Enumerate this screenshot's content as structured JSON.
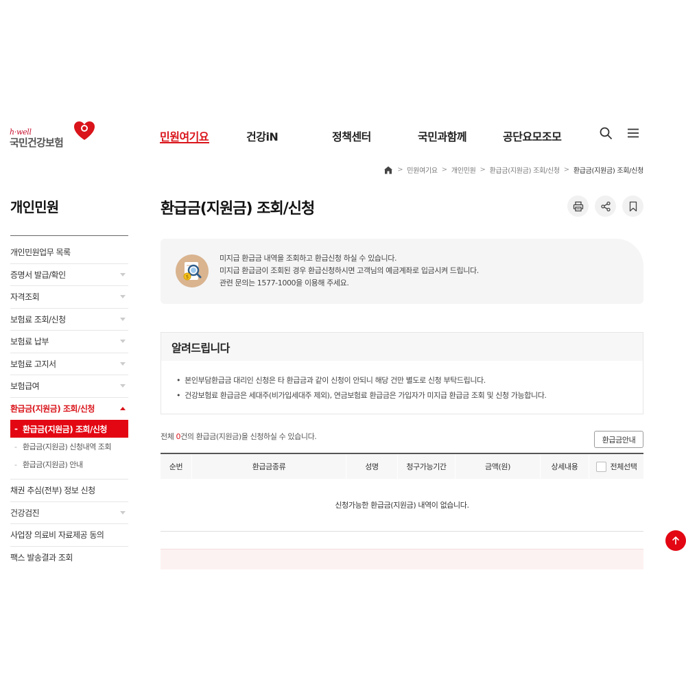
{
  "logo": {
    "small": "h·well",
    "name": "국민건강보험"
  },
  "gnb": {
    "items": [
      {
        "label": "민원여기요",
        "active": true
      },
      {
        "label": "건강iN",
        "active": false
      },
      {
        "label": "정책센터",
        "active": false
      },
      {
        "label": "국민과함께",
        "active": false
      },
      {
        "label": "공단요모조모",
        "active": false
      }
    ],
    "icons": [
      "search-icon",
      "menu-icon"
    ]
  },
  "breadcrumb": [
    "민원여기요",
    "개인민원",
    "환급금(지원금) 조회/신청",
    "환급금(지원금) 조회/신청"
  ],
  "side": {
    "title": "개인민원",
    "items": [
      {
        "label": "개인민원업무 목록",
        "arrow": false
      },
      {
        "label": "증명서 발급/확인",
        "arrow": true
      },
      {
        "label": "자격조회",
        "arrow": true
      },
      {
        "label": "보험료 조회/신청",
        "arrow": true
      },
      {
        "label": "보험료 납부",
        "arrow": true
      },
      {
        "label": "보험료 고지서",
        "arrow": true
      },
      {
        "label": "보험급여",
        "arrow": true
      }
    ],
    "open_item": "환급금(지원금) 조회/신청",
    "sub_items": [
      "환급금(지원금) 조회/신청",
      "환급금(지원금) 신청내역 조회",
      "환급금(지원금) 안내"
    ],
    "after_items": [
      {
        "label": "채권 추심(전부) 정보 신청",
        "arrow": false
      },
      {
        "label": "건강검진",
        "arrow": true
      },
      {
        "label": "사업장 의료비 자료제공 동의",
        "arrow": false
      },
      {
        "label": "팩스 발송결과 조회",
        "arrow": false
      }
    ]
  },
  "page": {
    "title": "환급금(지원금) 조회/신청"
  },
  "tools": [
    "print-icon",
    "share-icon",
    "bookmark-icon"
  ],
  "info": {
    "lines": [
      "미지급 환급금 내역을 조회하고 환급신청 하실 수 있습니다.",
      "미지급 환급금이 조회된 경우 환급신청하시면 고객님의 예금계좌로 입금시켜 드립니다.",
      "관련 문의는 1577-1000을 이용해 주세요."
    ]
  },
  "notice": {
    "title": "알려드립니다",
    "items": [
      "본인부담환급금 대리인 신청은 타 환급금과 같이 신청이 안되니 해당 건만 별도로 신청 부탁드립니다.",
      "건강보험료 환급금은 세대주(비가입세대주 제외), 연금보험료 환급금은 가입자가 미지급 환급금 조회 및 신청 가능합니다."
    ]
  },
  "summary": {
    "prefix": "전체 ",
    "count": "0",
    "suffix": "건의 환급금(지원금)을 신청하실 수 있습니다."
  },
  "guide_button": "환급금안내",
  "table": {
    "headers": [
      "순번",
      "환급금종류",
      "성명",
      "청구가능기간",
      "금액(원)",
      "상세내용",
      "전체선택"
    ],
    "empty": "신청가능한 환급금(지원금) 내역이 없습니다."
  },
  "colors": {
    "brand": "#d9141a",
    "accent_bg": "#e30613"
  }
}
